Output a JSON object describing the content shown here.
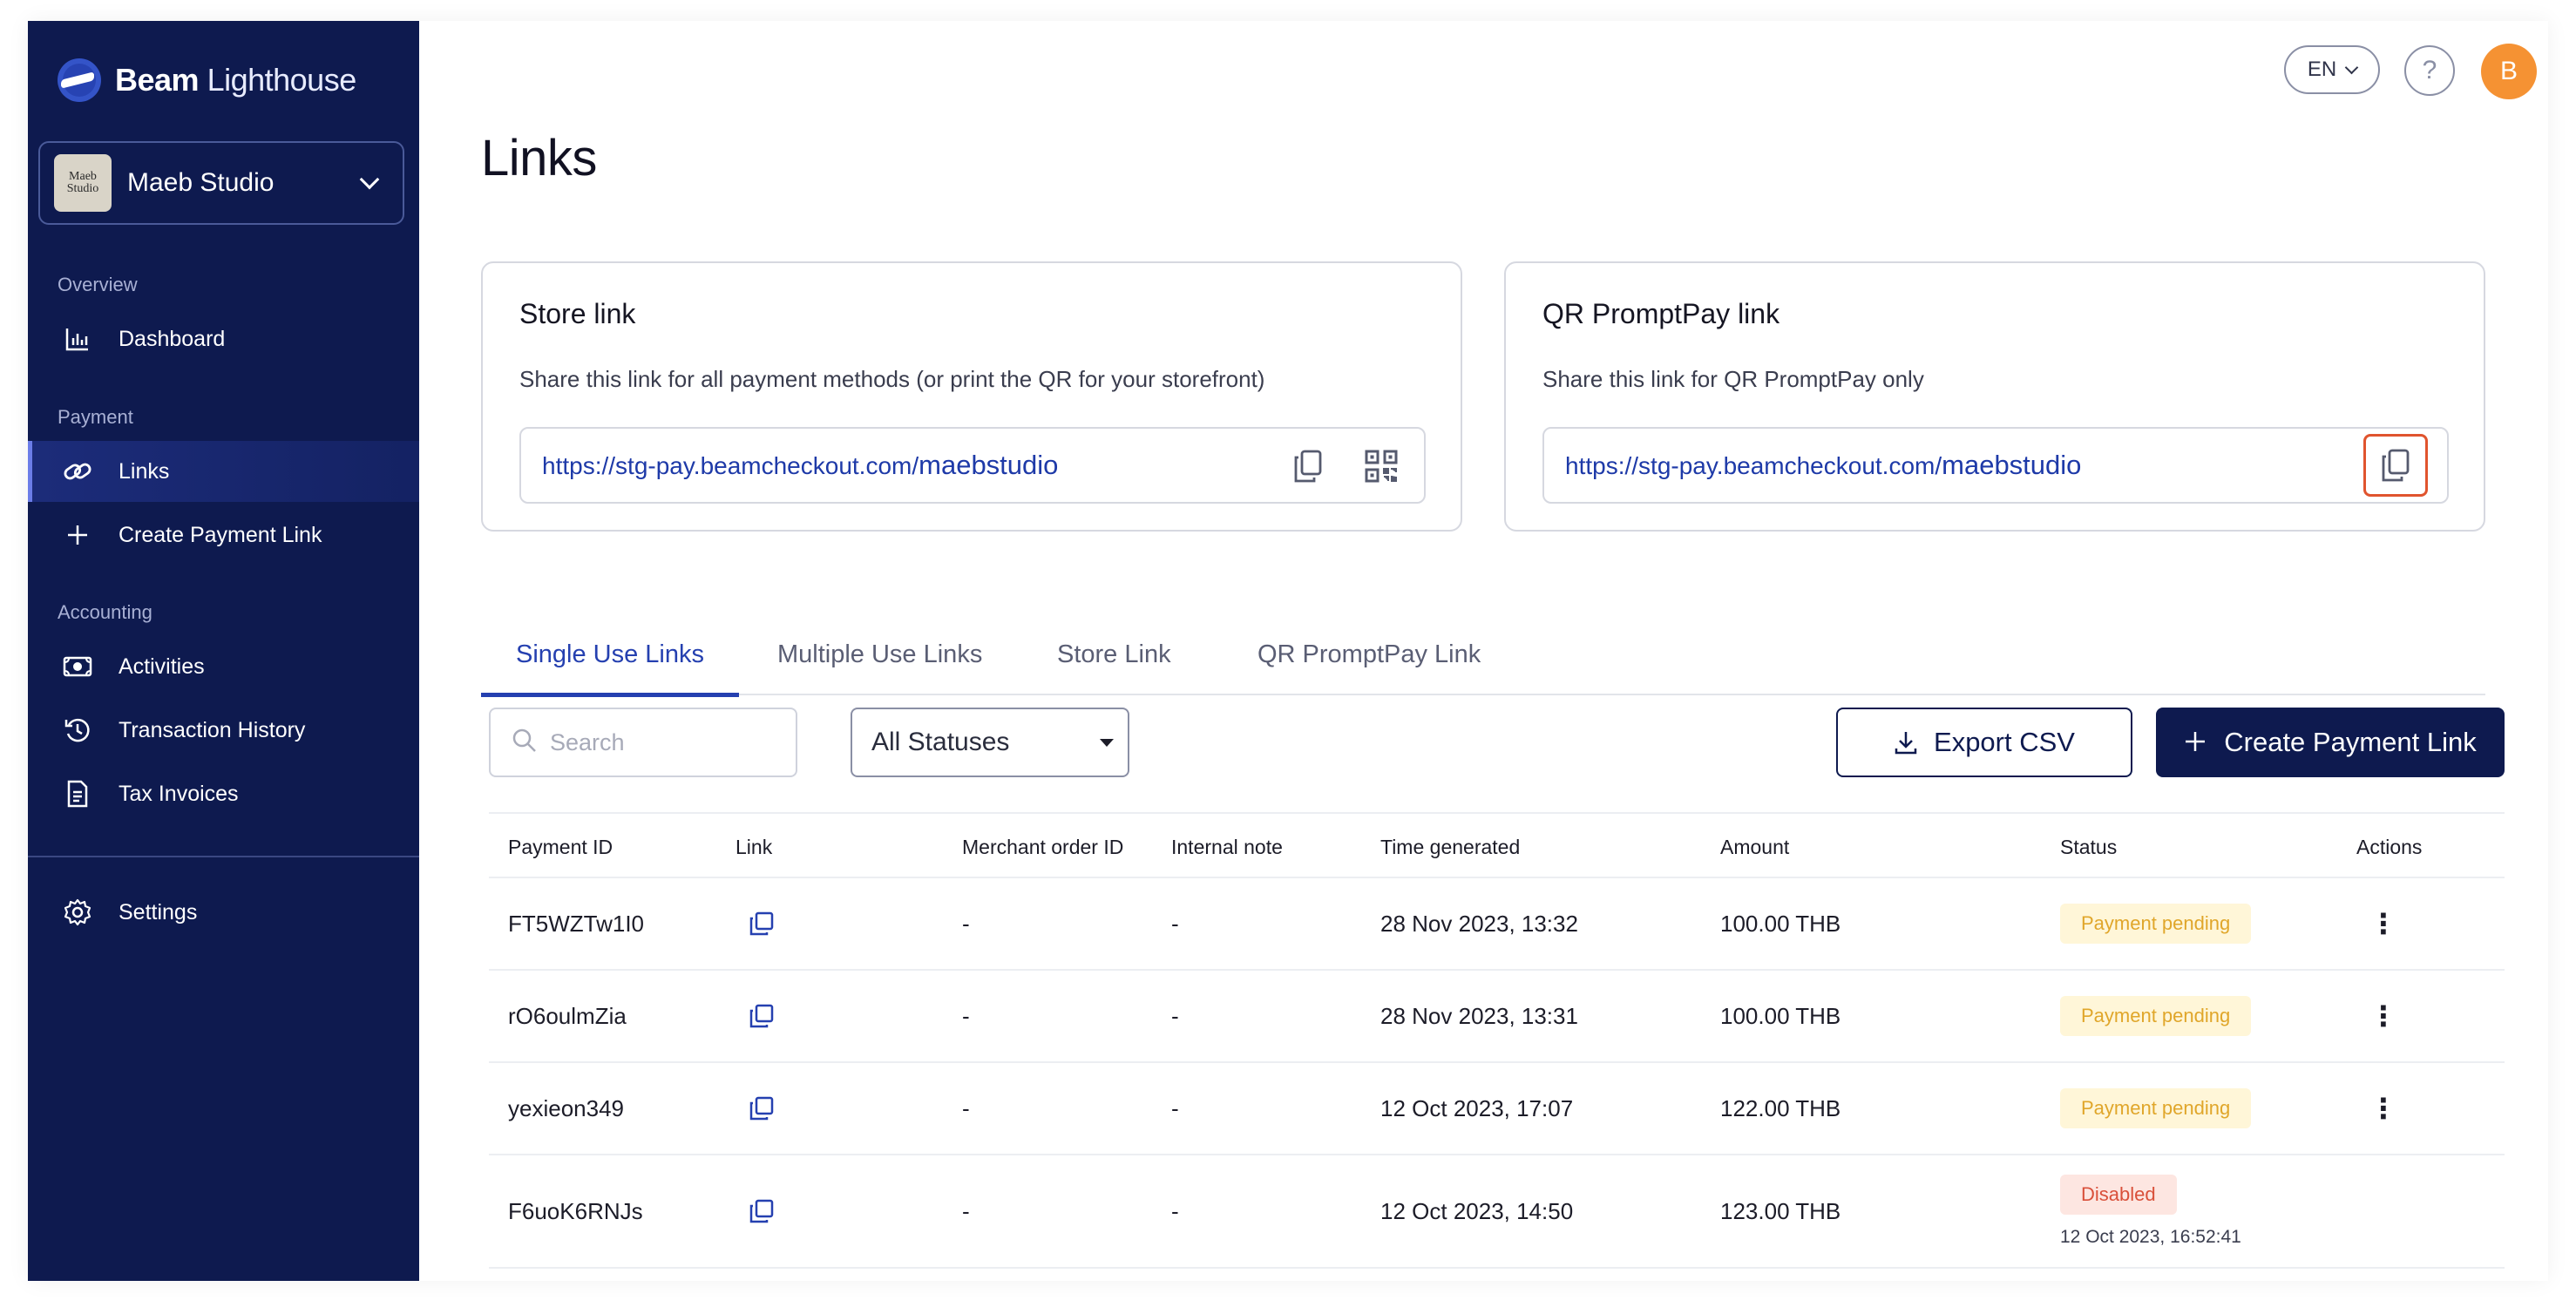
{
  "brand": {
    "name_bold": "Beam",
    "name_rest": " Lighthouse"
  },
  "store": {
    "avatar_text": "Maeb Studio",
    "name": "Maeb Studio"
  },
  "sidebar": {
    "sections": {
      "overview": "Overview",
      "payment": "Payment",
      "accounting": "Accounting"
    },
    "items": [
      {
        "label": "Dashboard",
        "icon": "bar-chart-icon"
      },
      {
        "label": "Links",
        "icon": "link-icon",
        "active": true
      },
      {
        "label": "Create Payment Link",
        "icon": "plus-icon"
      },
      {
        "label": "Activities",
        "icon": "money-icon"
      },
      {
        "label": "Transaction History",
        "icon": "history-icon"
      },
      {
        "label": "Tax Invoices",
        "icon": "document-icon"
      },
      {
        "label": "Settings",
        "icon": "gear-icon"
      }
    ]
  },
  "header": {
    "language": "EN",
    "help": "?",
    "user_initial": "B"
  },
  "page": {
    "title": "Links"
  },
  "store_link_card": {
    "title": "Store link",
    "description": "Share this link for all payment methods (or print the QR for your storefront)",
    "url_base": "https://stg-pay.beamcheckout.com/",
    "url_slug": "maebstudio"
  },
  "qr_card": {
    "title": "QR PromptPay link",
    "description": "Share this link for QR PromptPay only",
    "url_base": "https://stg-pay.beamcheckout.com/",
    "url_slug": "maebstudio"
  },
  "tabs": [
    {
      "label": "Single Use Links",
      "active": true
    },
    {
      "label": "Multiple Use Links"
    },
    {
      "label": "Store Link"
    },
    {
      "label": "QR PromptPay Link"
    }
  ],
  "toolbar": {
    "search_placeholder": "Search",
    "status_filter": "All Statuses",
    "export_label": "Export CSV",
    "create_label": "Create Payment Link"
  },
  "table": {
    "columns": [
      "Payment ID",
      "Link",
      "Merchant order ID",
      "Internal note",
      "Time generated",
      "Amount",
      "Status",
      "Actions"
    ],
    "rows": [
      {
        "payment_id": "FT5WZTw1I0",
        "merchant_order_id": "-",
        "internal_note": "-",
        "time": "28 Nov 2023, 13:32",
        "amount": "100.00 THB",
        "status": "Payment pending",
        "actions": "⋮"
      },
      {
        "payment_id": "rO6oulmZia",
        "merchant_order_id": "-",
        "internal_note": "-",
        "time": "28 Nov 2023, 13:31",
        "amount": "100.00 THB",
        "status": "Payment pending",
        "actions": "⋮"
      },
      {
        "payment_id": "yexieon349",
        "merchant_order_id": "-",
        "internal_note": "-",
        "time": "12 Oct 2023, 17:07",
        "amount": "122.00 THB",
        "status": "Payment pending",
        "actions": "⋮"
      },
      {
        "payment_id": "F6uoK6RNJs",
        "merchant_order_id": "-",
        "internal_note": "-",
        "time": "12 Oct 2023, 14:50",
        "amount": "123.00 THB",
        "status": "Disabled",
        "status_time": "12 Oct 2023, 16:52:41"
      }
    ]
  },
  "colors": {
    "sidebar_bg": "#0e1a4f",
    "accent": "#2540b0",
    "avatar": "#f59233",
    "pending_text": "#e0a62a",
    "disabled_text": "#d9503a",
    "focus_ring": "#e0542e"
  }
}
